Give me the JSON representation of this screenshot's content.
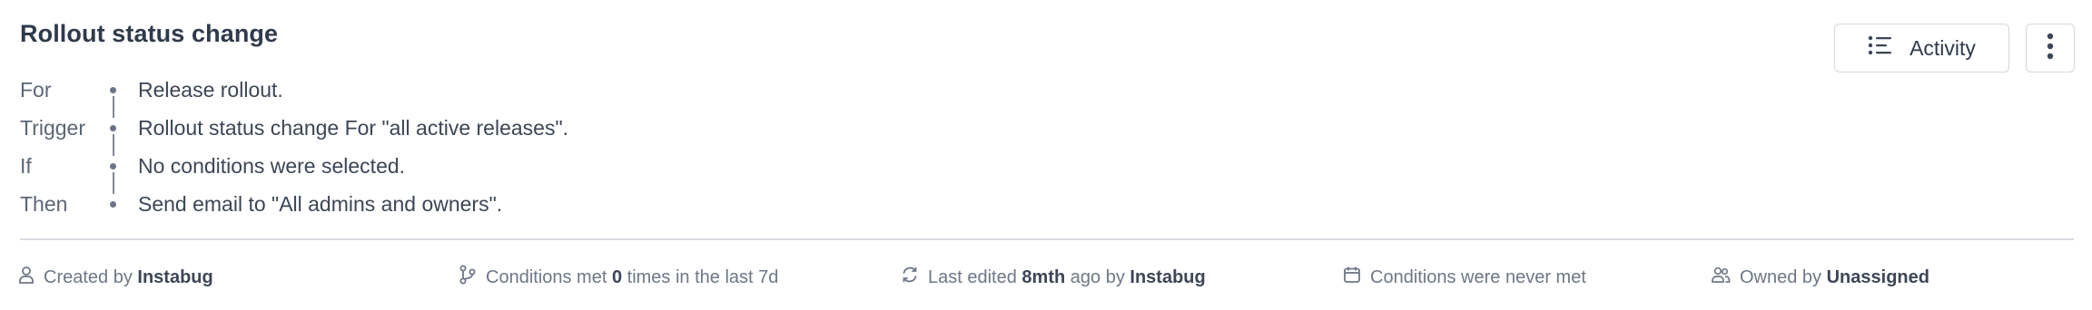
{
  "card": {
    "title": "Rollout status change",
    "rules": [
      {
        "key": "For",
        "value": "Release rollout."
      },
      {
        "key": "Trigger",
        "value": "Rollout status change For \"all active releases\"."
      },
      {
        "key": "If",
        "value": "No conditions were selected."
      },
      {
        "key": "Then",
        "value": "Send email to \"All admins and owners\"."
      }
    ],
    "actions": {
      "activity_label": "Activity",
      "activity_icon": "list-icon",
      "more_icon": "kebab-menu-icon"
    },
    "footer": {
      "created": {
        "prefix": "Created by ",
        "user": "Instabug",
        "icon": "user-icon"
      },
      "conditions": {
        "prefix": "Conditions met ",
        "count": "0",
        "suffix": " times in the last 7d",
        "icon": "branch-icon"
      },
      "edited": {
        "prefix": "Last edited ",
        "time": "8mth",
        "middle": " ago by ",
        "user": "Instabug",
        "icon": "refresh-icon"
      },
      "never_met": {
        "text": "Conditions were never met",
        "icon": "calendar-icon"
      },
      "owned": {
        "prefix": "Owned by ",
        "owner": "Unassigned",
        "icon": "users-icon"
      }
    }
  }
}
